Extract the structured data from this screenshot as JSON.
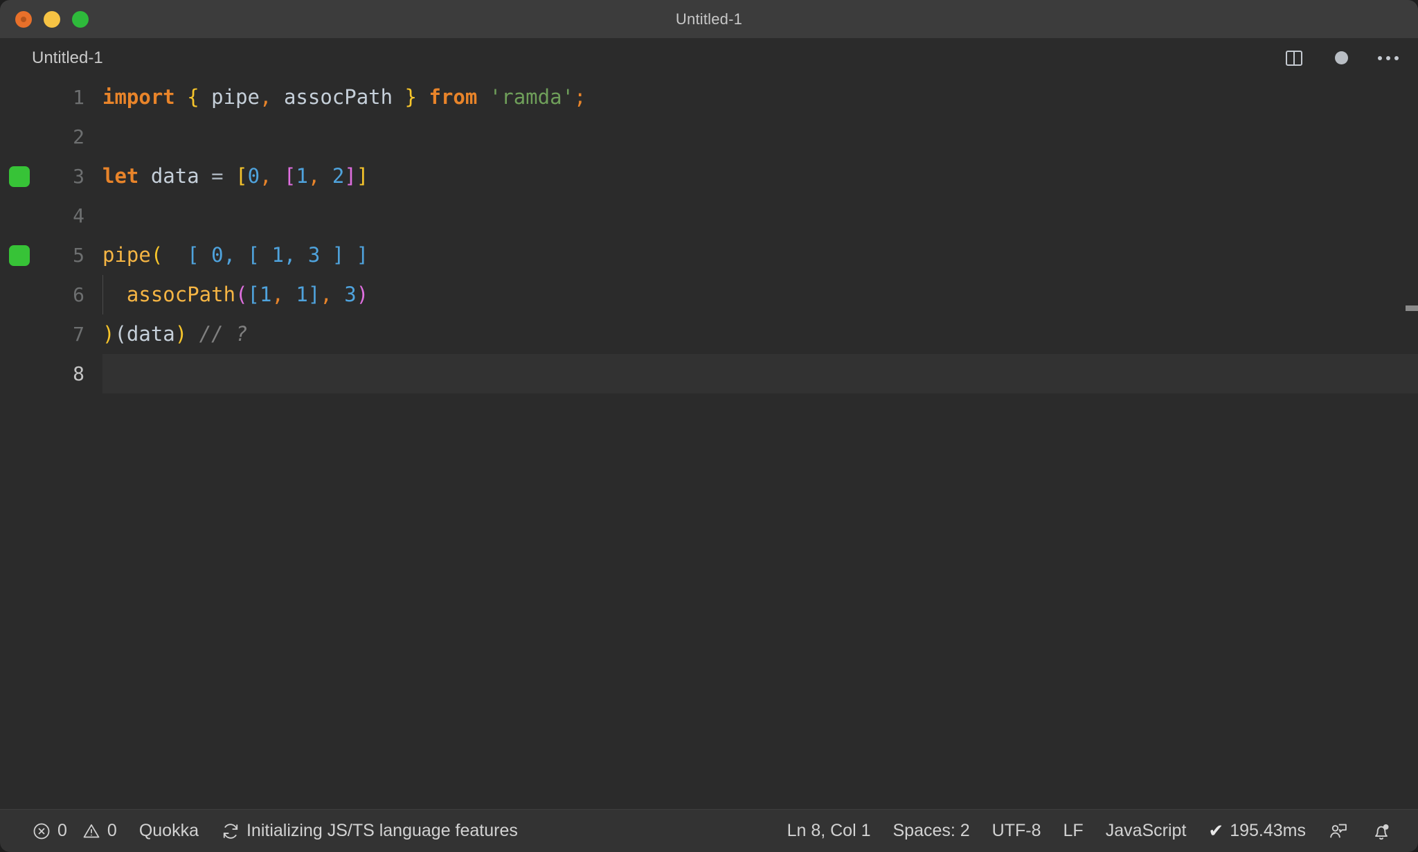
{
  "window": {
    "title": "Untitled-1",
    "controls": [
      {
        "name": "close",
        "color": "#e8702a"
      },
      {
        "name": "minimize",
        "color": "#f6c344"
      },
      {
        "name": "maximize",
        "color": "#2eba3b"
      }
    ]
  },
  "editor_header": {
    "doc_title": "Untitled-1",
    "actions": [
      {
        "icon": "split-editor-icon",
        "label": "Split Editor"
      },
      {
        "icon": "unsaved-dot-icon",
        "label": "Unsaved changes"
      },
      {
        "icon": "more-actions-icon",
        "label": "More Actions..."
      }
    ]
  },
  "code": {
    "language": "JavaScript",
    "lines": [
      {
        "number": "1",
        "quokka": false,
        "active": false,
        "indent_guide": false
      },
      {
        "number": "2",
        "quokka": false,
        "active": false,
        "indent_guide": false
      },
      {
        "number": "3",
        "quokka": true,
        "active": false,
        "indent_guide": false
      },
      {
        "number": "4",
        "quokka": false,
        "active": false,
        "indent_guide": false
      },
      {
        "number": "5",
        "quokka": true,
        "active": false,
        "indent_guide": false
      },
      {
        "number": "6",
        "quokka": false,
        "active": false,
        "indent_guide": true
      },
      {
        "number": "7",
        "quokka": false,
        "active": false,
        "indent_guide": false
      },
      {
        "number": "8",
        "quokka": false,
        "active": true,
        "indent_guide": false
      }
    ],
    "text": {
      "l1_import": "import",
      "l1_brace_open": "{",
      "l1_pipe": " pipe",
      "l1_comma": ",",
      "l1_assocpath": " assocPath ",
      "l1_brace_close": "}",
      "l1_from": "from",
      "l1_module": "'ramda'",
      "l1_semi": ";",
      "l3_let": "let",
      "l3_data": " data ",
      "l3_eq": "=",
      "l3_open_y": "[",
      "l3_zero": "0",
      "l3_comma1": ",",
      "l3_open_m": "[",
      "l3_one": "1",
      "l3_comma2": ",",
      "l3_two": "2",
      "l3_close_m": "]",
      "l3_close_y": "]",
      "l5_pipe": "pipe",
      "l5_paren": "(",
      "l5_value": "[ 0, [ 1, 3 ] ]",
      "l6_assocpath": "assocPath",
      "l6_paren_open": "(",
      "l6_bracket_open": "[",
      "l6_one_a": "1",
      "l6_comma_a": ",",
      "l6_one_b": " 1",
      "l6_bracket_close": "]",
      "l6_comma_b": ",",
      "l6_three": " 3",
      "l6_paren_close": ")",
      "l7_paren_close_y": ")",
      "l7_call": "(data",
      "l7_paren_close_y2": ")",
      "l7_comment": "// ?"
    }
  },
  "statusbar": {
    "problems": {
      "error_icon": "error-circle-icon",
      "error_count": "0",
      "warning_icon": "warning-triangle-icon",
      "warning_count": "0"
    },
    "quokka": "Quokka",
    "task": {
      "icon": "sync-spinner-icon",
      "text": "Initializing JS/TS language features"
    },
    "cursor": "Ln 8, Col 1",
    "indentation": "Spaces: 2",
    "encoding": "UTF-8",
    "eol": "LF",
    "language": "JavaScript",
    "run_time": "195.43ms",
    "run_check_icon": "checkmark-icon",
    "account_icon": "account-icon",
    "bell_icon": "bell-dot-icon"
  }
}
